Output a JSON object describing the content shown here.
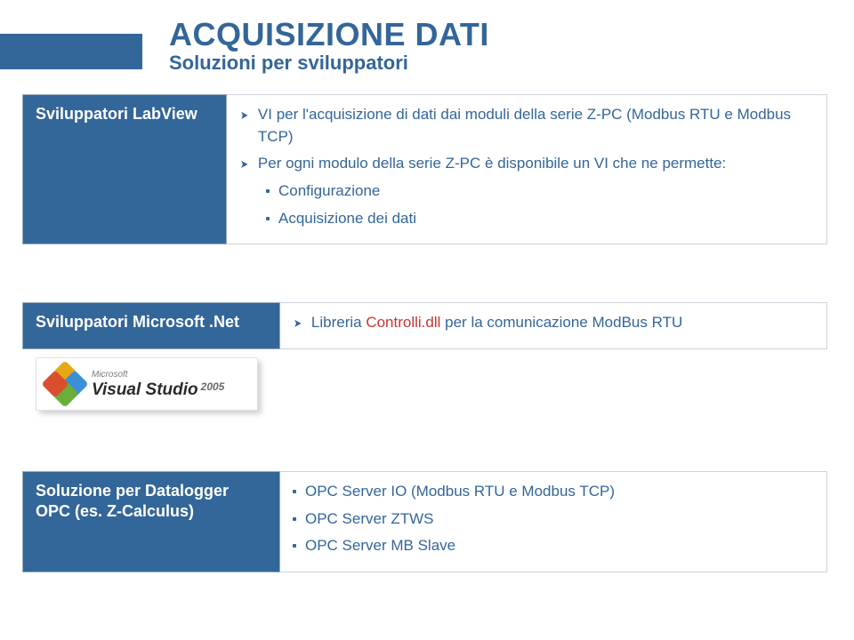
{
  "header": {
    "title": "ACQUISIZIONE DATI",
    "subtitle": "Soluzioni per sviluppatori"
  },
  "section1": {
    "label": "Sviluppatori LabView",
    "bullets": [
      "VI per l'acquisizione di dati dai moduli della serie Z-PC (Modbus RTU e Modbus TCP)",
      "Per ogni modulo della serie Z-PC è disponibile un VI che ne permette:"
    ],
    "subbullets": [
      "Configurazione",
      "Acquisizione dei dati"
    ]
  },
  "section2": {
    "label": "Sviluppatori Microsoft .Net",
    "bullet_prefix": "Libreria ",
    "bullet_highlight": "Controlli.dll",
    "bullet_suffix": " per la comunicazione ModBus RTU"
  },
  "section3": {
    "label": "Soluzione per Datalogger OPC (es. Z-Calculus)",
    "bullets": [
      "OPC Server IO (Modbus RTU e Modbus TCP)",
      "OPC Server ZTWS",
      "OPC Server MB Slave"
    ]
  },
  "vs_logo": {
    "brand": "Microsoft",
    "product": "Visual Studio",
    "year": "2005"
  }
}
